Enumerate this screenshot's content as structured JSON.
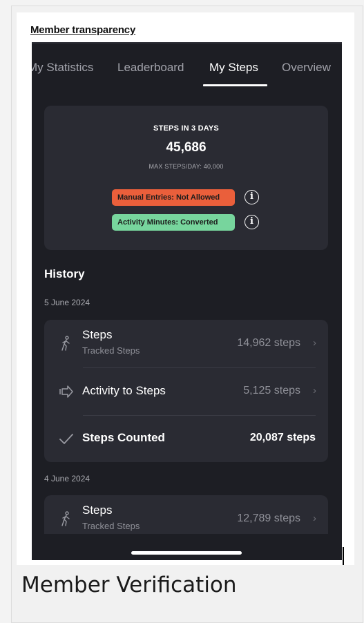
{
  "heading": "Member transparency",
  "caption": "Member Verification",
  "tabs": [
    {
      "label": "My Statistics"
    },
    {
      "label": "Leaderboard"
    },
    {
      "label": "My Steps"
    },
    {
      "label": "Overview"
    }
  ],
  "active_tab": "My Steps",
  "summary": {
    "label": "STEPS IN 3 DAYS",
    "value": "45,686",
    "max_per_day": "MAX STEPS/DAY: 40,000",
    "badges": [
      {
        "text": "Manual Entries: Not Allowed",
        "color": "#ea5f3b"
      },
      {
        "text": "Activity Minutes: Converted",
        "color": "#77d59d"
      }
    ]
  },
  "history": {
    "title": "History",
    "days": [
      {
        "date": "5 June 2024",
        "rows": [
          {
            "icon": "walking-icon",
            "title": "Steps",
            "subtitle": "Tracked Steps",
            "value": "14,962 steps"
          },
          {
            "icon": "arrow-right-icon",
            "title": "Activity to Steps",
            "value": "5,125 steps"
          },
          {
            "icon": "check-icon",
            "title": "Steps Counted",
            "value": "20,087 steps"
          }
        ]
      },
      {
        "date": "4 June 2024",
        "rows": [
          {
            "icon": "walking-icon",
            "title": "Steps",
            "subtitle": "Tracked Steps",
            "value": "12,789 steps"
          }
        ]
      }
    ]
  },
  "colors": {
    "phone_bg": "#1d1e24",
    "card_bg": "#2a2b33",
    "badge_red": "#ea5f3b",
    "badge_green": "#77d59d"
  }
}
